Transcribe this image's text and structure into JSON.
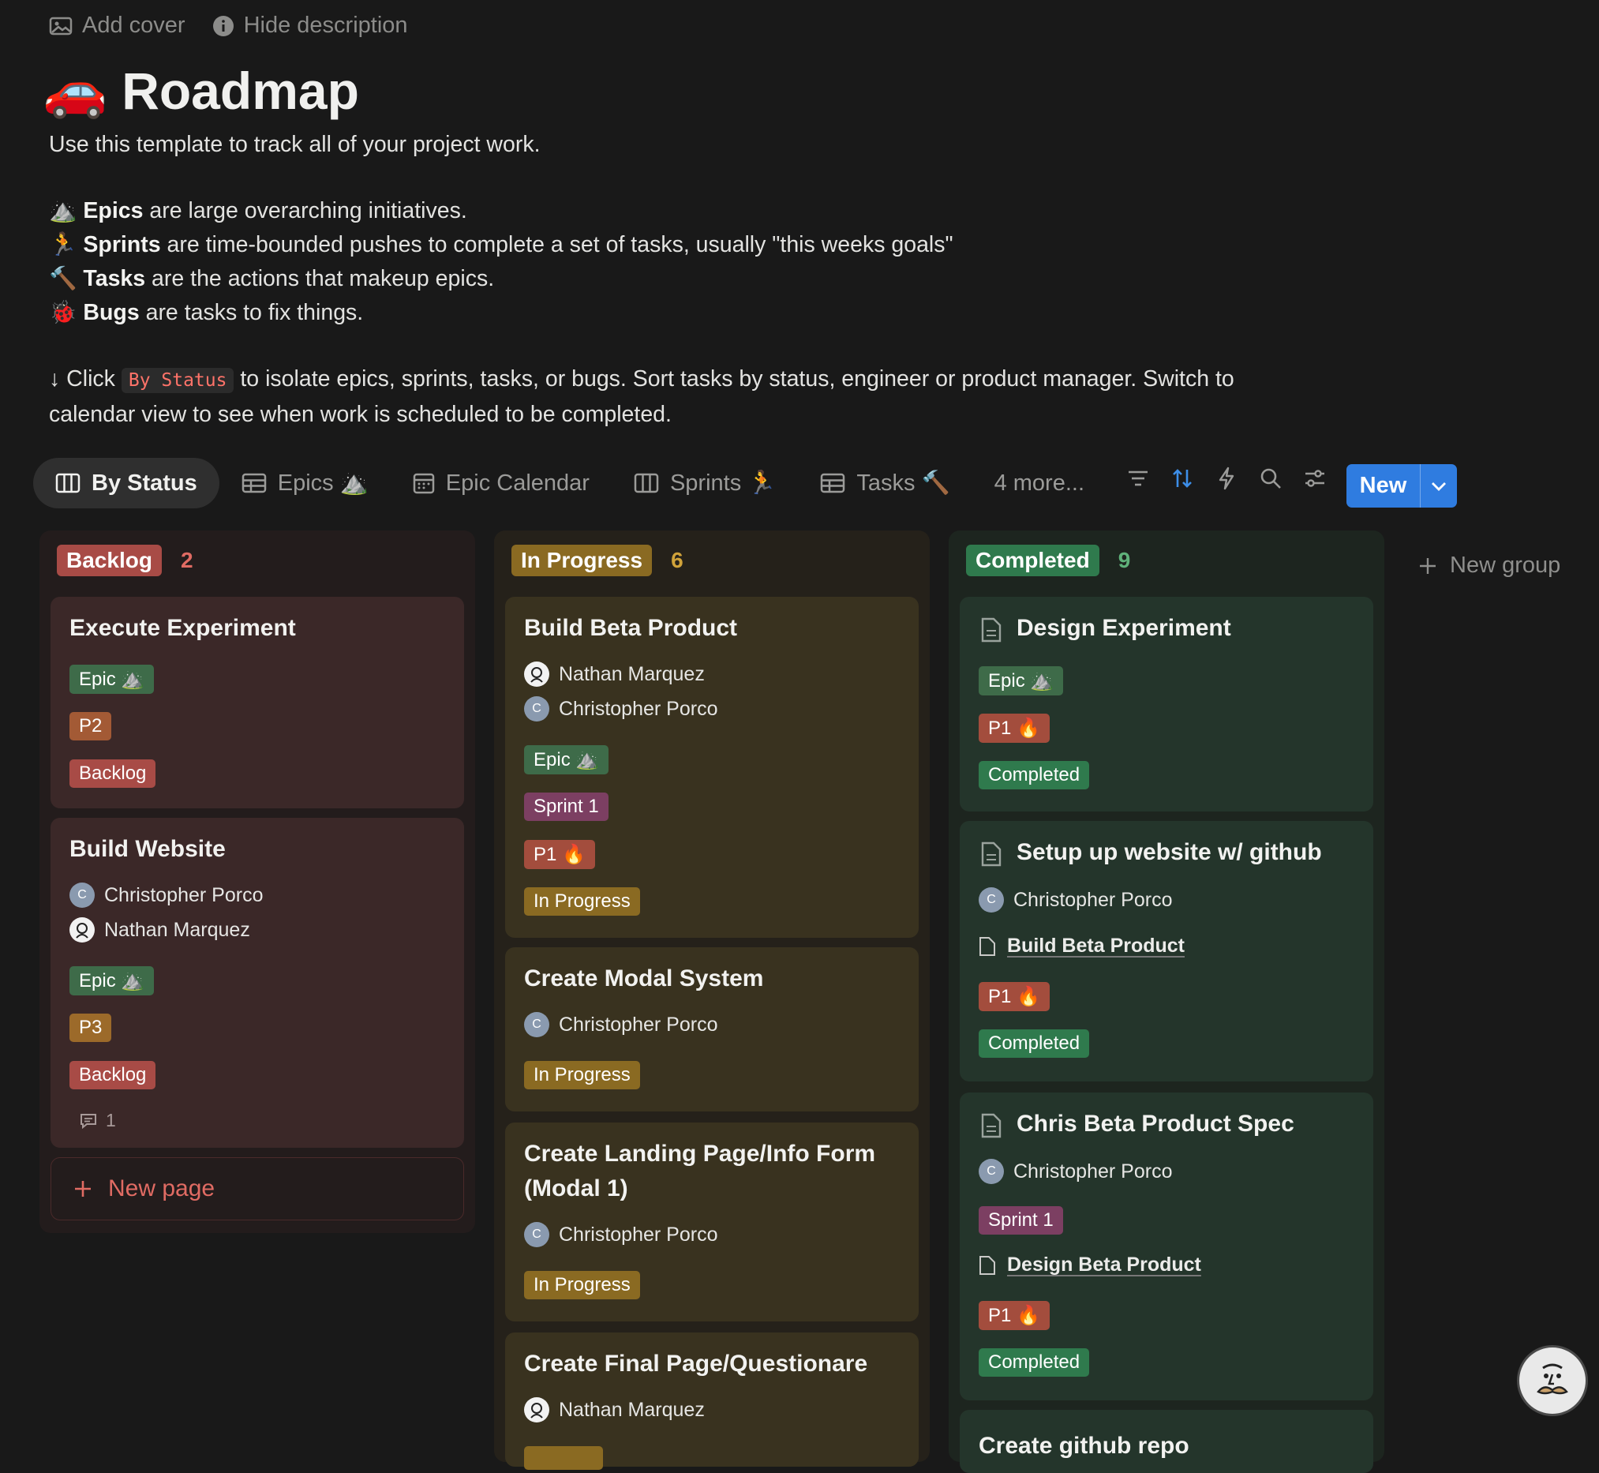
{
  "top_actions": {
    "add_cover": "Add cover",
    "hide_description": "Hide description"
  },
  "page": {
    "emoji": "🚗",
    "title": "Roadmap"
  },
  "description": {
    "intro": "Use this template to track all of your project work.",
    "lines": [
      {
        "emoji": "⛰️",
        "bold": "Epics",
        "rest": " are large overarching initiatives."
      },
      {
        "emoji": "🏃",
        "bold": "Sprints",
        "rest": " are time-bounded pushes to complete a set of tasks, usually \"this weeks goals\""
      },
      {
        "emoji": "🔨",
        "bold": "Tasks",
        "rest": " are the actions that makeup epics."
      },
      {
        "emoji": "🐞",
        "bold": "Bugs",
        "rest": " are tasks to fix things."
      }
    ],
    "click_prefix": "↓ Click ",
    "click_code": "By Status",
    "click_suffix": " to isolate epics, sprints, tasks, or bugs. Sort tasks by status, engineer or product manager. Switch to calendar view to see when work is scheduled to be completed."
  },
  "tabs": [
    {
      "label": "By Status",
      "icon": "board-icon",
      "emoji": ""
    },
    {
      "label": "Epics",
      "icon": "table-icon",
      "emoji": "⛰️"
    },
    {
      "label": "Epic Calendar",
      "icon": "calendar-icon",
      "emoji": ""
    },
    {
      "label": "Sprints",
      "icon": "board-icon",
      "emoji": "🏃"
    },
    {
      "label": "Tasks",
      "icon": "table-icon",
      "emoji": "🔨"
    }
  ],
  "more_tabs": "4 more...",
  "new_button": "New",
  "new_group": "New group",
  "new_page": "New page",
  "colors": {
    "accent": "#2f7ce0",
    "background": "#191919"
  },
  "columns": [
    {
      "name": "Backlog",
      "count": "2",
      "cards": [
        {
          "title": "Execute Experiment",
          "tags": [
            "Epic ⛰️",
            "P2",
            "Backlog"
          ]
        },
        {
          "title": "Build Website",
          "people": [
            "Christopher Porco",
            "Nathan Marquez"
          ],
          "tags": [
            "Epic ⛰️",
            "P3",
            "Backlog"
          ],
          "comments": "1"
        }
      ]
    },
    {
      "name": "In Progress",
      "count": "6",
      "cards": [
        {
          "title": "Build Beta Product",
          "people": [
            "Nathan Marquez",
            "Christopher Porco"
          ],
          "tags": [
            "Epic ⛰️",
            "Sprint 1",
            "P1 🔥",
            "In Progress"
          ]
        },
        {
          "title": "Create Modal System",
          "people": [
            "Christopher Porco"
          ],
          "tags": [
            "In Progress"
          ]
        },
        {
          "title_line1": "Create Landing Page/Info Form",
          "title_line2": "(Modal 1)",
          "people": [
            "Christopher Porco"
          ],
          "tags": [
            "In Progress"
          ]
        },
        {
          "title": "Create Final Page/Questionare",
          "people": [
            "Nathan Marquez"
          ]
        }
      ]
    },
    {
      "name": "Completed",
      "count": "9",
      "cards": [
        {
          "title": "Design Experiment",
          "tags": [
            "Epic ⛰️",
            "P1 🔥",
            "Completed"
          ]
        },
        {
          "title": "Setup up website w/ github",
          "people": [
            "Christopher Porco"
          ],
          "relation": "Build Beta Product",
          "tags": [
            "P1 🔥",
            "Completed"
          ]
        },
        {
          "title": "Chris Beta Product Spec",
          "people": [
            "Christopher Porco"
          ],
          "sprint": "Sprint 1",
          "relation": "Design Beta Product",
          "tags": [
            "P1 🔥",
            "Completed"
          ]
        },
        {
          "title": "Create github repo"
        }
      ]
    }
  ]
}
